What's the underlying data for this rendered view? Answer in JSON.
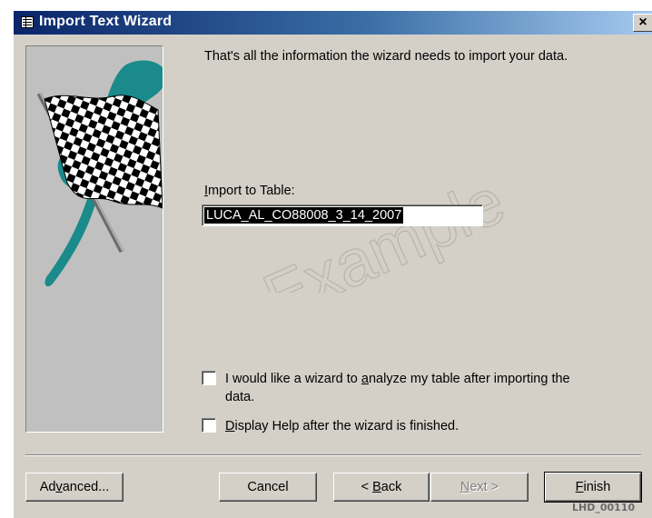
{
  "window": {
    "title": "Import Text Wizard",
    "close_label": "×"
  },
  "content": {
    "message": "That's all the information the wizard needs to import your data.",
    "import_label_pre": "",
    "import_label_u": "I",
    "import_label_post": "mport to Table:",
    "table_name": "LUCA_AL_CO88008_3_14_2007",
    "watermark": "Example"
  },
  "options": {
    "analyze": {
      "line1_pre": "I would like a wizard to ",
      "line1_u": "a",
      "line1_post": "nalyze my table after importing the",
      "line2": "data.",
      "checked": false
    },
    "help": {
      "pre": "",
      "u": "D",
      "post": "isplay Help after the wizard is finished.",
      "checked": false
    }
  },
  "buttons": {
    "advanced": {
      "pre": "Ad",
      "u": "v",
      "post": "anced..."
    },
    "cancel": {
      "label": "Cancel"
    },
    "back": {
      "pre": "< ",
      "u": "B",
      "post": "ack"
    },
    "next": {
      "pre": "",
      "u": "N",
      "post": "ext >"
    },
    "finish": {
      "pre": "",
      "u": "F",
      "post": "inish"
    }
  },
  "footer": {
    "code": "LHD_00110"
  },
  "colors": {
    "titlebar_start": "#0a246a",
    "titlebar_end": "#a6caf0",
    "dialog": "#d4d0c8",
    "flag_teal": "#1a8a8a"
  },
  "icons": [
    "dialog-icon",
    "close-icon",
    "checkered-flag-graphic"
  ]
}
